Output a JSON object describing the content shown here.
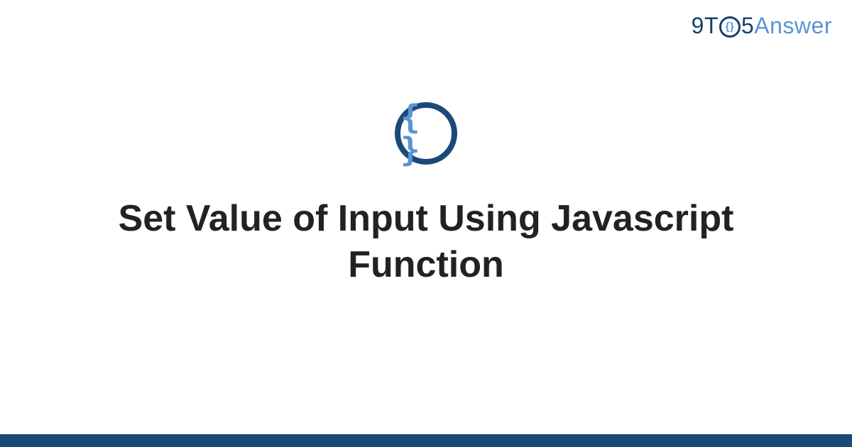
{
  "header": {
    "logo_part1": "9T",
    "logo_circle_inner": "{}",
    "logo_part2": "5",
    "logo_part3": "Answer"
  },
  "main": {
    "icon_glyph": "{ }",
    "title": "Set Value of Input Using Javascript Function"
  },
  "colors": {
    "brand_dark": "#1a4a78",
    "brand_light": "#5b94d6",
    "text": "#222222"
  }
}
